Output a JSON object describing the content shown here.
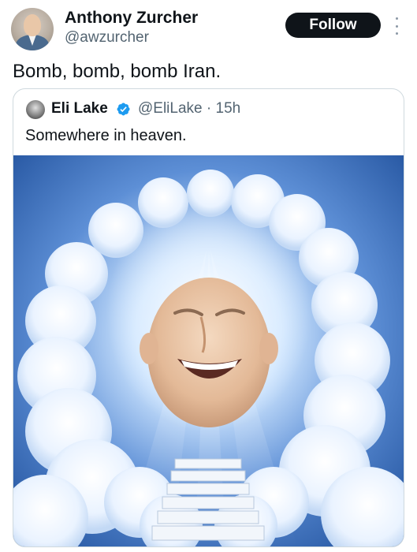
{
  "author": {
    "display_name": "Anthony Zurcher",
    "handle": "@awzurcher"
  },
  "follow_label": "Follow",
  "tweet": {
    "text": "Bomb, bomb, bomb Iran."
  },
  "quote": {
    "display_name": "Eli Lake",
    "handle": "@EliLake",
    "separator": "·",
    "time": "15h",
    "text": "Somewhere in heaven.",
    "verified_color": "#1d9bf0"
  },
  "colors": {
    "follow_bg": "#0f1419",
    "sky_dark": "#1f56a8",
    "sky_light": "#cfe6ff"
  }
}
